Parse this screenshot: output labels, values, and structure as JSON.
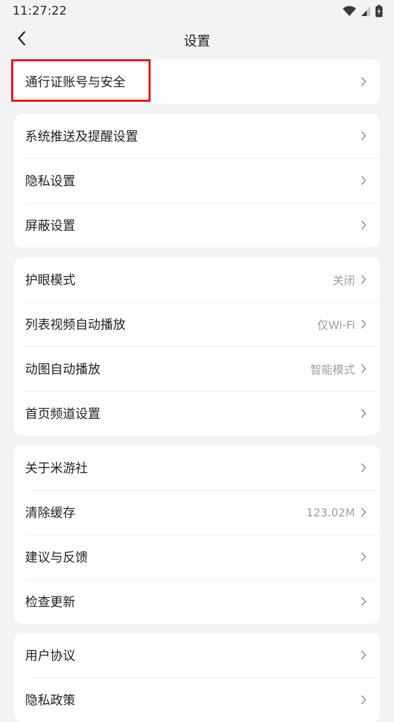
{
  "status_bar": {
    "time": "11:27:22",
    "icons": [
      "wifi-icon",
      "signal-icon",
      "battery-icon"
    ]
  },
  "header": {
    "title": "设置",
    "back_icon": "back-arrow-icon"
  },
  "colors": {
    "background": "#f2f3f5",
    "card": "#ffffff",
    "text": "#222222",
    "secondary_text": "#9a9ea6",
    "highlight": "#e8141b"
  },
  "groups": [
    {
      "items": [
        {
          "label": "通行证账号与安全",
          "value": ""
        }
      ]
    },
    {
      "items": [
        {
          "label": "系统推送及提醒设置",
          "value": ""
        },
        {
          "label": "隐私设置",
          "value": ""
        },
        {
          "label": "屏蔽设置",
          "value": ""
        }
      ]
    },
    {
      "items": [
        {
          "label": "护眼模式",
          "value": "关闭"
        },
        {
          "label": "列表视频自动播放",
          "value": "仅Wi-Fi"
        },
        {
          "label": "动图自动播放",
          "value": "智能模式"
        },
        {
          "label": "首页频道设置",
          "value": ""
        }
      ]
    },
    {
      "items": [
        {
          "label": "关于米游社",
          "value": ""
        },
        {
          "label": "清除缓存",
          "value": "123.02M"
        },
        {
          "label": "建议与反馈",
          "value": ""
        },
        {
          "label": "检查更新",
          "value": ""
        }
      ]
    },
    {
      "items": [
        {
          "label": "用户协议",
          "value": ""
        },
        {
          "label": "隐私政策",
          "value": ""
        }
      ]
    }
  ]
}
